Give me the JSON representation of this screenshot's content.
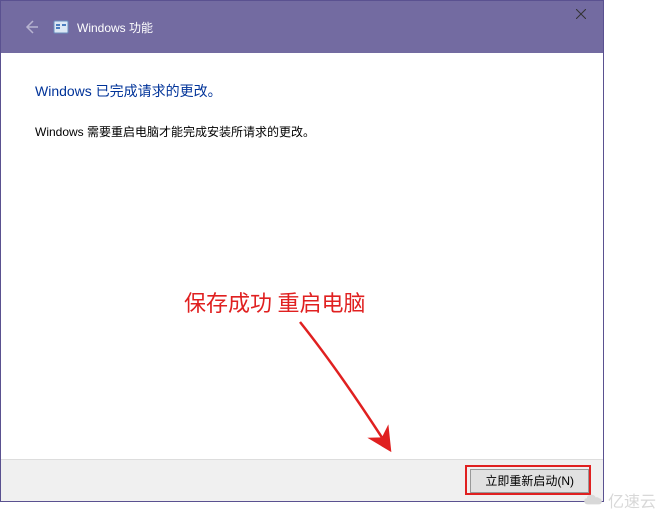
{
  "titlebar": {
    "back_icon_name": "back-arrow-icon",
    "app_icon_name": "windows-features-icon",
    "title": "Windows 功能",
    "close_icon_name": "close-icon"
  },
  "content": {
    "heading": "Windows 已完成请求的更改。",
    "body": "Windows 需要重启电脑才能完成安装所请求的更改。"
  },
  "footer": {
    "restart_label": "立即重新启动(N)"
  },
  "annotation": {
    "text": "保存成功 重启电脑",
    "color": "#e02020"
  },
  "watermark": {
    "text": "亿速云"
  }
}
